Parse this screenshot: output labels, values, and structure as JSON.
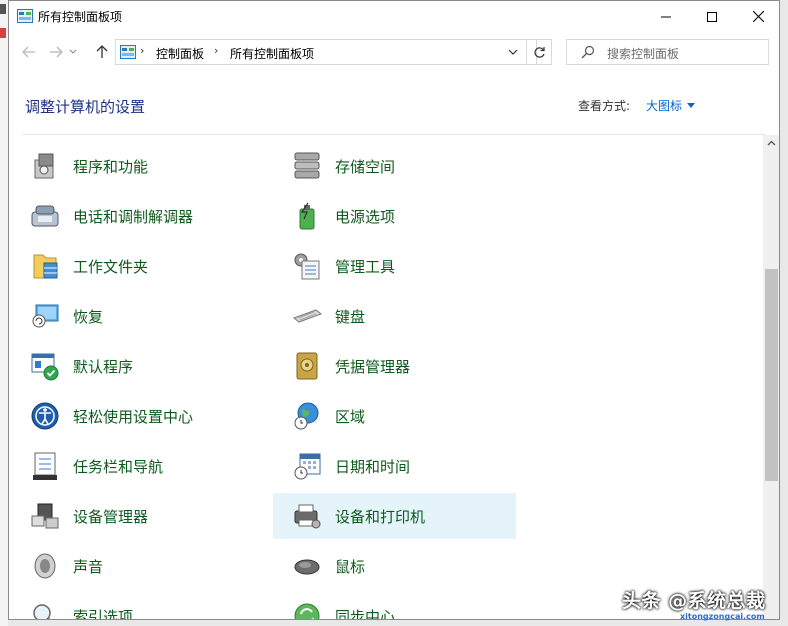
{
  "window": {
    "title": "所有控制面板项",
    "controls": {
      "minimize": "minimize-icon",
      "maximize": "maximize-icon",
      "close": "close-icon"
    }
  },
  "address_bar": {
    "breadcrumbs": [
      "控制面板",
      "所有控制面板项"
    ],
    "search_placeholder": "搜索控制面板"
  },
  "header": {
    "title": "调整计算机的设置",
    "view_by_label": "查看方式:",
    "view_by_value": "大图标"
  },
  "items": [
    {
      "label": "程序和功能",
      "icon": "programs-icon"
    },
    {
      "label": "存储空间",
      "icon": "storage-icon"
    },
    {
      "label": "电话和调制解调器",
      "icon": "phone-modem-icon"
    },
    {
      "label": "电源选项",
      "icon": "power-icon"
    },
    {
      "label": "工作文件夹",
      "icon": "work-folders-icon"
    },
    {
      "label": "管理工具",
      "icon": "admin-tools-icon"
    },
    {
      "label": "恢复",
      "icon": "recovery-icon"
    },
    {
      "label": "键盘",
      "icon": "keyboard-icon"
    },
    {
      "label": "默认程序",
      "icon": "default-programs-icon"
    },
    {
      "label": "凭据管理器",
      "icon": "credential-manager-icon"
    },
    {
      "label": "轻松使用设置中心",
      "icon": "ease-of-access-icon"
    },
    {
      "label": "区域",
      "icon": "region-icon"
    },
    {
      "label": "任务栏和导航",
      "icon": "taskbar-icon"
    },
    {
      "label": "日期和时间",
      "icon": "date-time-icon"
    },
    {
      "label": "设备管理器",
      "icon": "device-manager-icon"
    },
    {
      "label": "设备和打印机",
      "icon": "devices-printers-icon",
      "selected": true
    },
    {
      "label": "声音",
      "icon": "sound-icon"
    },
    {
      "label": "鼠标",
      "icon": "mouse-icon"
    },
    {
      "label": "索引选项",
      "icon": "indexing-icon"
    },
    {
      "label": "同步中心",
      "icon": "sync-center-icon"
    }
  ],
  "watermark": {
    "text": "头条 @系统总裁",
    "sub": "xitongzongcai.com"
  },
  "colors": {
    "heading": "#1e3287",
    "item_text": "#0d5a1c",
    "link": "#0066cc",
    "selection": "#e5f3fb"
  }
}
